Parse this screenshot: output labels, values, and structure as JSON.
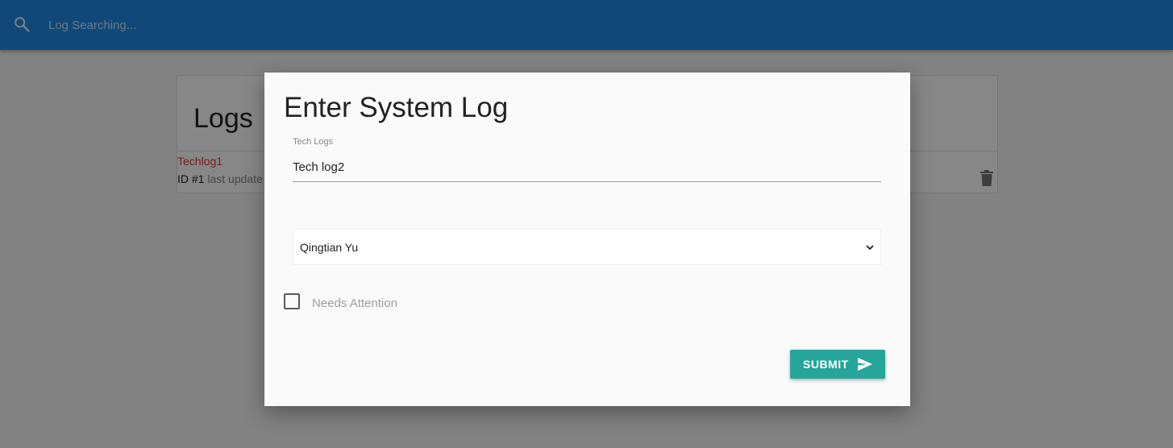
{
  "navbar": {
    "search_placeholder": "Log Searching...",
    "search_icon": "search-icon",
    "color": "#1e88e5"
  },
  "logs": {
    "title": "Logs",
    "items": [
      {
        "name": "Techlog1",
        "id_label": "ID #1",
        "last_updated_text": "last update"
      }
    ]
  },
  "modal": {
    "title": "Enter System Log",
    "tech_field": {
      "label": "Tech Logs",
      "value": "Tech log2"
    },
    "technician_select": {
      "selected": "Qingtian Yu"
    },
    "attention_checkbox": {
      "label": "Needs Attention",
      "checked": false
    },
    "submit_label": "SUBMIT",
    "submit_icon": "send-icon",
    "submit_color": "#26a69a"
  }
}
